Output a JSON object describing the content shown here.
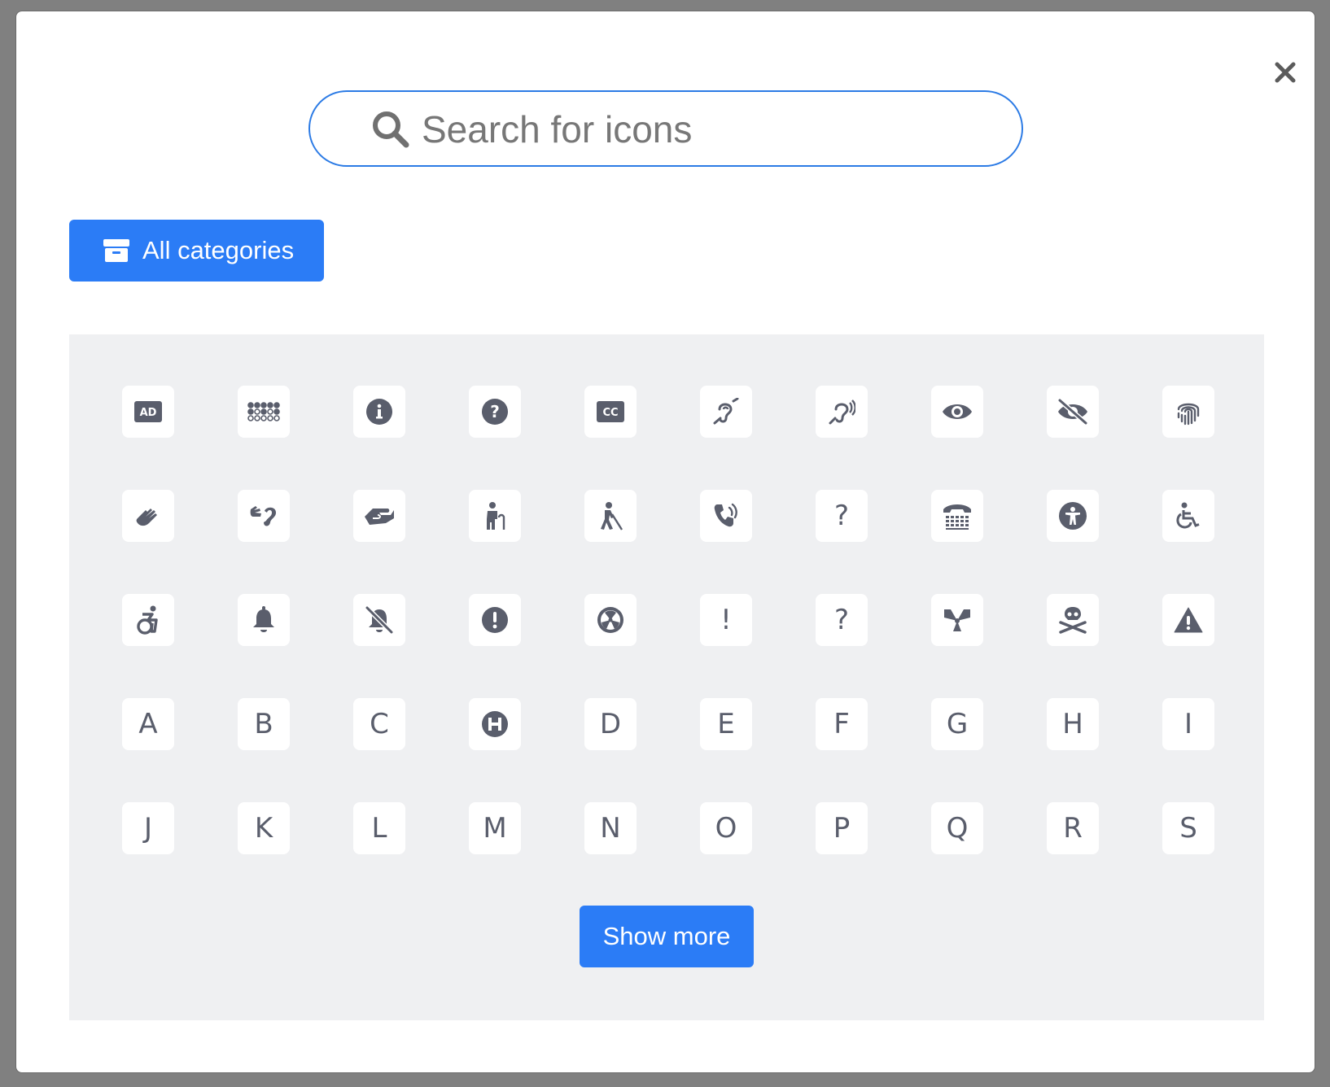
{
  "search": {
    "placeholder": "Search for icons"
  },
  "category_button": {
    "label": "All categories"
  },
  "show_more": {
    "label": "Show more"
  },
  "icons": [
    {
      "name": "audio-description-icon",
      "type": "svg"
    },
    {
      "name": "braille-icon",
      "type": "svg"
    },
    {
      "name": "info-circle-icon",
      "type": "svg"
    },
    {
      "name": "question-circle-icon",
      "type": "svg"
    },
    {
      "name": "closed-captioning-icon",
      "type": "svg"
    },
    {
      "name": "deaf-icon",
      "type": "svg"
    },
    {
      "name": "assistive-listening-icon",
      "type": "svg"
    },
    {
      "name": "eye-icon",
      "type": "svg"
    },
    {
      "name": "eye-slash-icon",
      "type": "svg"
    },
    {
      "name": "fingerprint-icon",
      "type": "svg"
    },
    {
      "name": "sign-language-icon",
      "type": "svg"
    },
    {
      "name": "american-sign-language-icon",
      "type": "svg"
    },
    {
      "name": "hands-holding-icon",
      "type": "svg"
    },
    {
      "name": "person-cane-icon",
      "type": "svg"
    },
    {
      "name": "person-walking-with-cane-icon",
      "type": "svg"
    },
    {
      "name": "phone-volume-icon",
      "type": "svg"
    },
    {
      "name": "question-icon",
      "type": "text",
      "text": "?"
    },
    {
      "name": "tty-icon",
      "type": "svg"
    },
    {
      "name": "universal-access-icon",
      "type": "svg"
    },
    {
      "name": "wheelchair-icon",
      "type": "svg"
    },
    {
      "name": "wheelchair-move-icon",
      "type": "svg"
    },
    {
      "name": "bell-icon",
      "type": "svg"
    },
    {
      "name": "bell-slash-icon",
      "type": "svg"
    },
    {
      "name": "circle-exclamation-icon",
      "type": "svg"
    },
    {
      "name": "radiation-circle-icon",
      "type": "svg"
    },
    {
      "name": "exclamation-icon",
      "type": "text",
      "text": "!"
    },
    {
      "name": "question-mark-icon",
      "type": "text",
      "text": "?"
    },
    {
      "name": "radiation-icon",
      "type": "svg"
    },
    {
      "name": "skull-crossbones-icon",
      "type": "svg"
    },
    {
      "name": "triangle-exclamation-icon",
      "type": "svg"
    },
    {
      "name": "letter-a-icon",
      "type": "text",
      "text": "A"
    },
    {
      "name": "letter-b-icon",
      "type": "text",
      "text": "B"
    },
    {
      "name": "letter-c-icon",
      "type": "text",
      "text": "C"
    },
    {
      "name": "hospital-h-icon",
      "type": "svg"
    },
    {
      "name": "letter-d-icon",
      "type": "text",
      "text": "D"
    },
    {
      "name": "letter-e-icon",
      "type": "text",
      "text": "E"
    },
    {
      "name": "letter-f-icon",
      "type": "text",
      "text": "F"
    },
    {
      "name": "letter-g-icon",
      "type": "text",
      "text": "G"
    },
    {
      "name": "letter-h-icon",
      "type": "text",
      "text": "H"
    },
    {
      "name": "letter-i-icon",
      "type": "text",
      "text": "I"
    },
    {
      "name": "letter-j-icon",
      "type": "text",
      "text": "J"
    },
    {
      "name": "letter-k-icon",
      "type": "text",
      "text": "K"
    },
    {
      "name": "letter-l-icon",
      "type": "text",
      "text": "L"
    },
    {
      "name": "letter-m-icon",
      "type": "text",
      "text": "M"
    },
    {
      "name": "letter-n-icon",
      "type": "text",
      "text": "N"
    },
    {
      "name": "letter-o-icon",
      "type": "text",
      "text": "O"
    },
    {
      "name": "letter-p-icon",
      "type": "text",
      "text": "P"
    },
    {
      "name": "letter-q-icon",
      "type": "text",
      "text": "Q"
    },
    {
      "name": "letter-r-icon",
      "type": "text",
      "text": "R"
    },
    {
      "name": "letter-s-icon",
      "type": "text",
      "text": "S"
    }
  ],
  "colors": {
    "accent": "#2b7cf6",
    "icon": "#5a5e6c",
    "panel": "#eff0f2",
    "backdrop": "#808080"
  }
}
